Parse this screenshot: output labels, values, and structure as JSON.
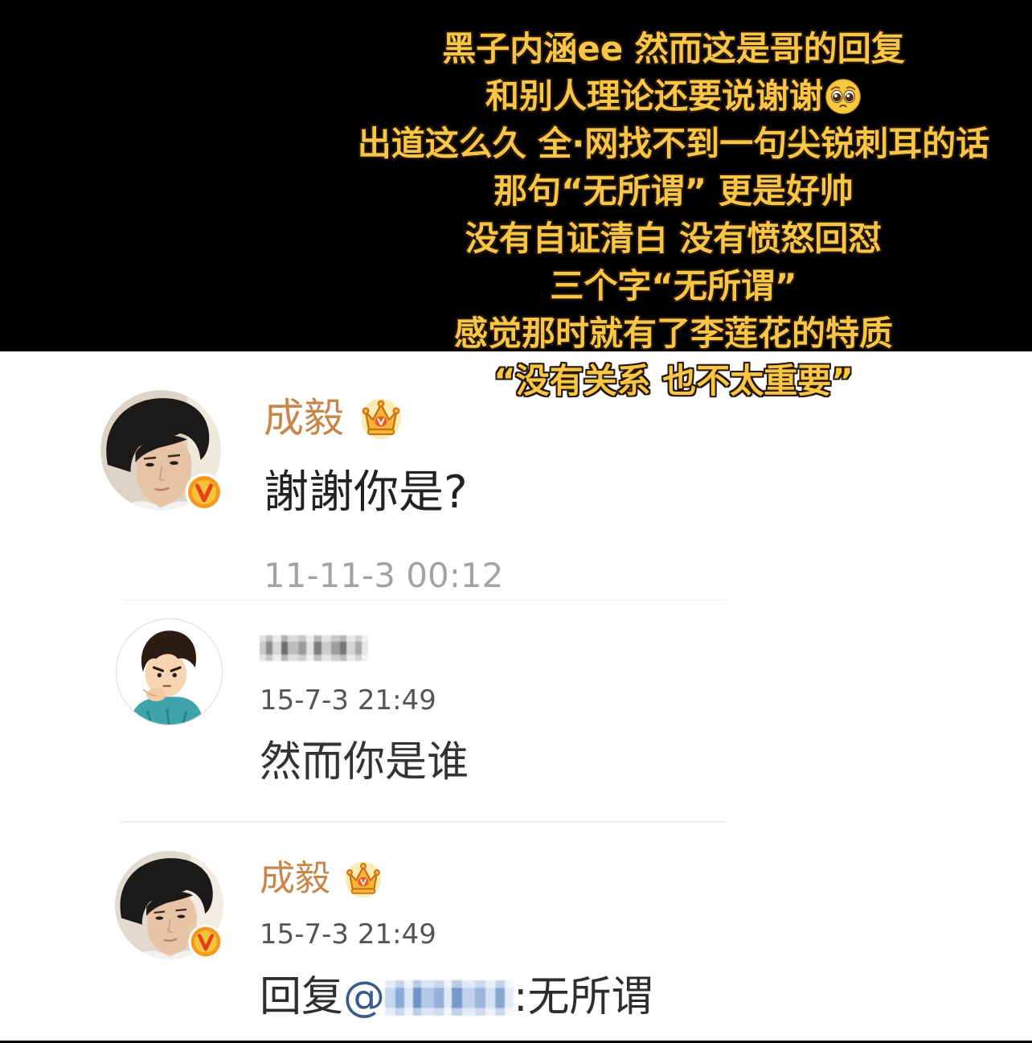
{
  "overlay": {
    "lines": [
      "黑子内涵ee 然而这是哥的回复",
      "和别人理论还要说谢谢",
      "出道这么久 全·网找不到一句尖锐刺耳的话",
      "那句“无所谓” 更是好帅",
      "没有自证清白 没有愤怒回怼",
      "三个字“无所谓”",
      "感觉那时就有了李莲花的特质",
      "“没有关系 也不太重要”"
    ],
    "emoji_icon": "pleading-face-icon"
  },
  "comments": [
    {
      "name": "成毅",
      "member_icon": "crown-icon",
      "badge_icon": "verified-v-icon",
      "text": "謝謝你是?",
      "time": "11-11-3 00:12"
    },
    {
      "time": "15-7-3 21:49",
      "text": "然而你是谁"
    },
    {
      "name": "成毅",
      "member_icon": "crown-icon",
      "badge_icon": "verified-v-icon",
      "time": "15-7-3 21:49",
      "reply_prefix": "回复",
      "mention_at": "@",
      "reply_suffix": ":无所谓"
    }
  ],
  "colors": {
    "background_top": "#000000",
    "background_main": "#ffffff",
    "overlay_text": "#f8c545",
    "overlay_outline": "#24170a",
    "username": "#c8864b",
    "comment_text": "#262626",
    "timestamp_light": "#a3a3a3",
    "timestamp": "#555555",
    "mention": "#3b5b8c",
    "divider": "#eeeeee"
  }
}
